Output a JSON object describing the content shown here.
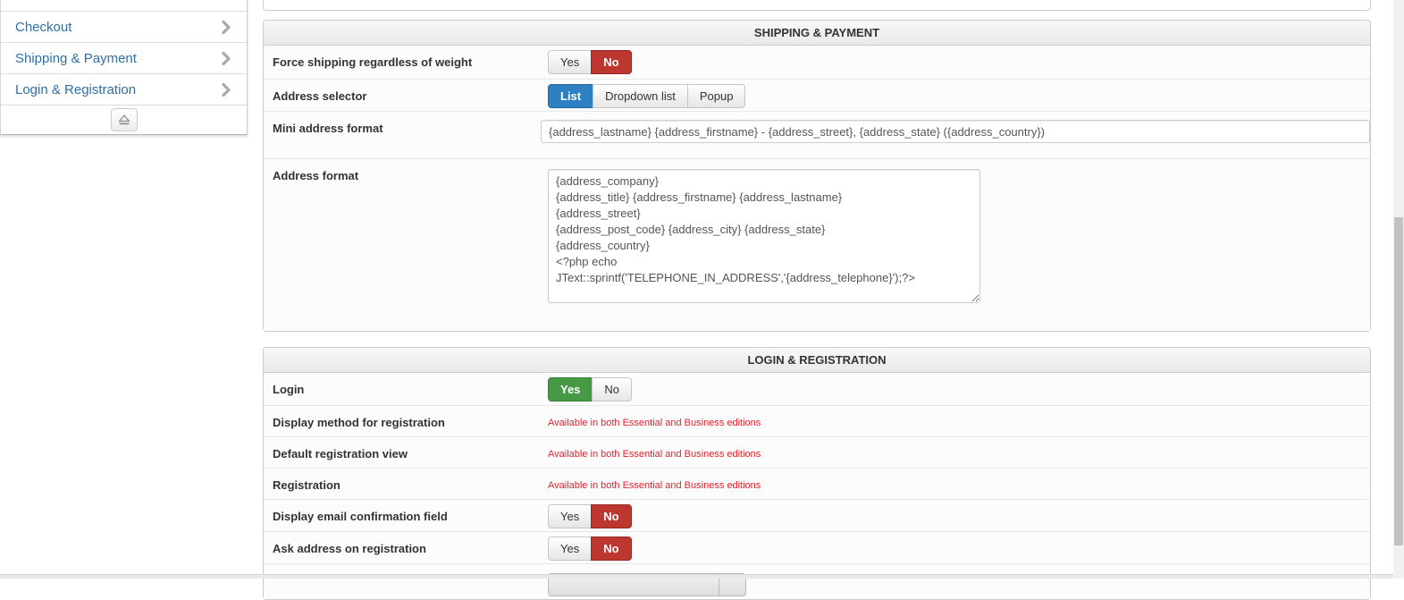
{
  "sidebar": {
    "items": [
      {
        "label": "Checkout"
      },
      {
        "label": "Shipping & Payment"
      },
      {
        "label": "Login & Registration"
      }
    ]
  },
  "sections": [
    {
      "id": "shipping-payment",
      "title": "SHIPPING & PAYMENT",
      "rows": [
        {
          "label": "Force shipping regardless of weight",
          "control": "toggle",
          "options": [
            "Yes",
            "No"
          ],
          "selected": "No",
          "selected_style": "danger"
        },
        {
          "label": "Address selector",
          "control": "toggle",
          "options": [
            "List",
            "Dropdown list",
            "Popup"
          ],
          "selected": "List",
          "selected_style": "primary"
        },
        {
          "label": "Mini address format",
          "control": "input",
          "value": "{address_lastname} {address_firstname} - {address_street}, {address_state} ({address_country})"
        },
        {
          "label": "Address format",
          "control": "textarea",
          "value": "{address_company}\n{address_title} {address_firstname} {address_lastname}\n{address_street}\n{address_post_code} {address_city} {address_state}\n{address_country}\n<?php echo JText::sprintf('TELEPHONE_IN_ADDRESS','{address_telephone}');?>"
        }
      ]
    },
    {
      "id": "login-registration",
      "title": "LOGIN & REGISTRATION",
      "rows": [
        {
          "label": "Login",
          "control": "toggle",
          "options": [
            "Yes",
            "No"
          ],
          "selected": "Yes",
          "selected_style": "success"
        },
        {
          "label": "Display method for registration",
          "control": "notice",
          "value": "Available in both Essential and Business editions"
        },
        {
          "label": "Default registration view",
          "control": "notice",
          "value": "Available in both Essential and Business editions"
        },
        {
          "label": "Registration",
          "control": "notice",
          "value": "Available in both Essential and Business editions"
        },
        {
          "label": "Display email confirmation field",
          "control": "toggle",
          "options": [
            "Yes",
            "No"
          ],
          "selected": "No",
          "selected_style": "danger"
        },
        {
          "label": "Ask address on registration",
          "control": "toggle",
          "options": [
            "Yes",
            "No"
          ],
          "selected": "No",
          "selected_style": "danger"
        },
        {
          "label": "",
          "control": "select-partial",
          "value": ""
        }
      ]
    }
  ],
  "colors": {
    "danger": "#bd362f",
    "primary": "#2d80c2",
    "success": "#469a46",
    "notice_red": "#e5202a",
    "sidebar_link": "#2f6fa8"
  }
}
